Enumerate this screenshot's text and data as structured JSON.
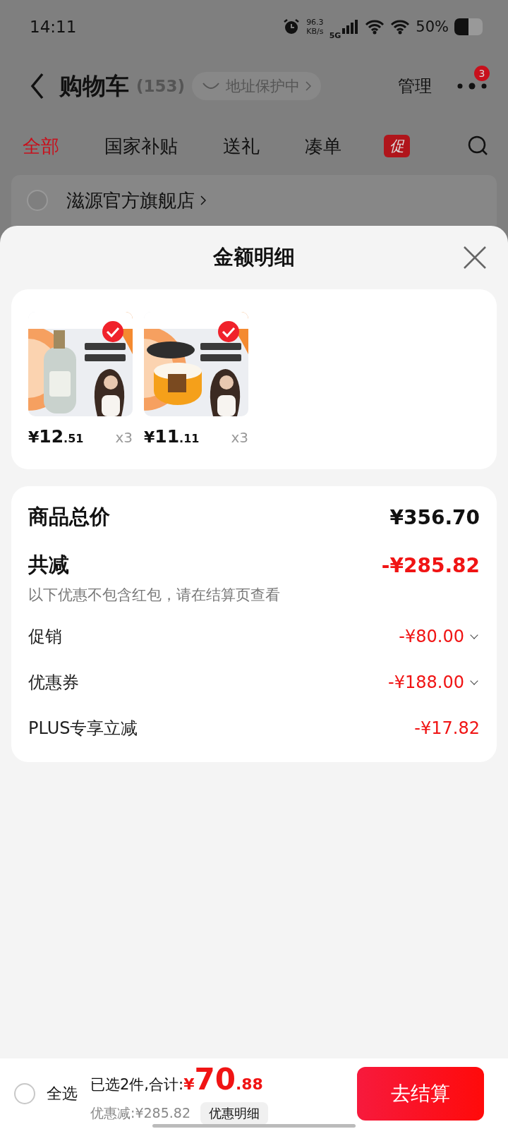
{
  "status_bar": {
    "time": "14:11",
    "net_speed": "96.3",
    "net_unit": "KB/s",
    "network": "5G",
    "battery": "50%"
  },
  "header": {
    "title": "购物车",
    "count": "(153)",
    "address_pill": "地址保护中",
    "manage": "管理",
    "menu_badge": "3"
  },
  "tabs": [
    {
      "label": "全部",
      "selected": true
    },
    {
      "label": "国家补贴",
      "selected": false
    },
    {
      "label": "送礼",
      "selected": false
    },
    {
      "label": "凑单",
      "selected": false
    }
  ],
  "promo_tag": "促",
  "store": {
    "name": "滋源官方旗舰店",
    "checked": false
  },
  "sheet": {
    "title": "金额明细",
    "items": [
      {
        "kind": "picture",
        "checked": true,
        "currency": "¥",
        "price_int": "12",
        "price_dec": ".51",
        "qty": "x3"
      },
      {
        "kind": "picture",
        "checked": true,
        "currency": "¥",
        "price_int": "11",
        "price_dec": ".11",
        "qty": "x3"
      }
    ],
    "total": {
      "label": "商品总价",
      "value": "¥356.70"
    },
    "reduction": {
      "label": "共减",
      "value": "-¥285.82",
      "note": "以下优惠不包含红包，请在结算页查看"
    },
    "discounts": [
      {
        "label": "促销",
        "value": "-¥80.00",
        "expandable": true
      },
      {
        "label": "优惠券",
        "value": "-¥188.00",
        "expandable": true
      },
      {
        "label": "PLUS专享立减",
        "value": "-¥17.82",
        "expandable": false
      }
    ]
  },
  "footer": {
    "select_all": {
      "label": "全选",
      "checked": false
    },
    "selected_text": "已选2件,合计:",
    "currency": "¥",
    "total_int": "70",
    "total_dec": ".88",
    "saved": "优惠减:¥285.82",
    "details_button": "优惠明细",
    "checkout": "去结算"
  }
}
